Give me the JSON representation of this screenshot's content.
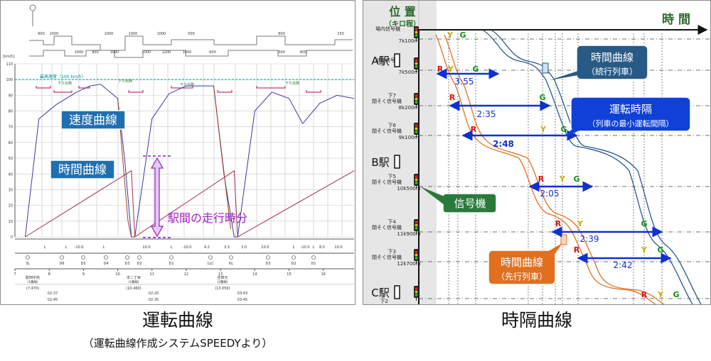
{
  "left": {
    "caption": "運転曲線",
    "subcaption": "（運転曲線作成システムSPEEDYより）",
    "y_unit": "[km/h]",
    "y_ticks": [
      "110",
      "100",
      "90",
      "80",
      "70",
      "60",
      "50",
      "40",
      "30",
      "20",
      "10",
      "0"
    ],
    "x_ticks": [
      "7",
      "8",
      "9",
      "10",
      "11",
      "12",
      "13",
      "14",
      "15",
      "16"
    ],
    "speed_limit_label": "最高速度（100 km/h）",
    "label_speed_curve": "速度曲線",
    "label_time_curve": "時間曲線",
    "label_run_time": "駅間の走行時分",
    "top_distance_labels": [
      "600",
      "1000",
      "1000",
      "1000",
      "1000",
      "500",
      "600",
      "150"
    ],
    "mid_distance_labels": [
      "1000",
      "900",
      "1000",
      "1000",
      "1200",
      "1000",
      "600",
      "500",
      "400"
    ],
    "limit_labels": [
      "下り出発",
      "下り出発",
      "下り出発",
      "下り出発"
    ],
    "gradient_labels": [
      "L",
      "L",
      "-10.0",
      "L",
      "10.0",
      "L",
      "-10.0",
      "4.2",
      "3.3",
      "3.0",
      "10.0",
      "L",
      "-10.0",
      "L",
      "8.0",
      "10.0"
    ],
    "signal_labels": [
      "3L",
      "D6",
      "D5",
      "D4",
      "D3",
      "D2",
      "D1",
      "1LC",
      "6L",
      "D3",
      "D2",
      "D1"
    ],
    "stations": [
      {
        "name": "駅田中央",
        "sub": "(1番線)",
        "km": "(7.470)",
        "arr": "02:37",
        "dep": "02:45"
      },
      {
        "name": "本二丁目",
        "sub": "(1番線)",
        "km": "(10.460)",
        "arr": "02:20",
        "dep": "02:30"
      },
      {
        "name": "吉田元",
        "sub": "(2番線)",
        "km": "(13.050)",
        "arr": "03:43",
        "dep": "03:45"
      }
    ],
    "chart_data": {
      "type": "line",
      "ylabel": "[km/h]",
      "ylim": [
        0,
        110
      ],
      "xlim": [
        7,
        16.9
      ],
      "speed_limit": 100,
      "series": [
        {
          "name": "速度曲線",
          "values": [
            [
              7.3,
              0
            ],
            [
              7.7,
              75
            ],
            [
              8.2,
              84
            ],
            [
              8.8,
              92
            ],
            [
              9.2,
              96
            ],
            [
              9.5,
              97
            ],
            [
              10.0,
              88
            ],
            [
              10.2,
              50
            ],
            [
              10.4,
              0
            ],
            [
              10.5,
              0
            ],
            [
              11.0,
              75
            ],
            [
              11.5,
              91
            ],
            [
              12.0,
              96
            ],
            [
              12.8,
              96
            ],
            [
              13.1,
              40
            ],
            [
              13.4,
              0
            ],
            [
              13.5,
              0
            ],
            [
              14.0,
              80
            ],
            [
              14.5,
              92
            ],
            [
              15.0,
              88
            ],
            [
              15.4,
              72
            ],
            [
              15.9,
              85
            ],
            [
              16.4,
              90
            ],
            [
              16.9,
              88
            ]
          ]
        },
        {
          "name": "時間曲線",
          "values": [
            [
              7.3,
              0
            ],
            [
              10.4,
              42
            ],
            [
              10.5,
              0
            ],
            [
              13.4,
              42
            ],
            [
              13.5,
              0
            ],
            [
              16.9,
              42
            ]
          ]
        }
      ]
    }
  },
  "right": {
    "caption": "時隔曲線",
    "axis_pos": "位 置",
    "axis_pos_sub": "（キロ程）",
    "axis_time": "時 間",
    "stations": [
      {
        "name": "A駅",
        "km": "7k100m"
      },
      {
        "name": "B駅",
        "km": ""
      },
      {
        "name": "C駅",
        "km": ""
      }
    ],
    "signals": [
      {
        "label": "場内信号機",
        "km": "7k100m"
      },
      {
        "label": "出発信号機",
        "km": "7k500m"
      },
      {
        "label": "下7",
        "sub": "閉そく信号機",
        "km": "8k200m"
      },
      {
        "label": "下6",
        "sub": "閉そく信号機",
        "km": "9k100m"
      },
      {
        "label": "下5",
        "sub": "閉そく信号機",
        "km": "10k500m"
      },
      {
        "label": "下4",
        "sub": "閉そく信号機",
        "km": "11k900m"
      },
      {
        "label": "下3",
        "sub": "閉そく信号機",
        "km": "12k700m"
      },
      {
        "label": "下2",
        "sub": "",
        "km": ""
      }
    ],
    "intervals": [
      "3:55",
      "2:35",
      "2:48",
      "2:05",
      "2:39",
      "2:42"
    ],
    "aspects": {
      "r": "R",
      "y": "Y",
      "g": "G"
    },
    "callout_follow_title": "時間曲線",
    "callout_follow_sub": "（続行列車）",
    "callout_headway_title": "運転時隔",
    "callout_headway_sub": "（列車の最小運転間隔）",
    "callout_signal": "信号機",
    "callout_lead_title": "時間曲線",
    "callout_lead_sub": "（先行列車）",
    "colors": {
      "lead": "#e07020",
      "follow": "#2a5a8a",
      "arrow": "#1030d0"
    }
  }
}
